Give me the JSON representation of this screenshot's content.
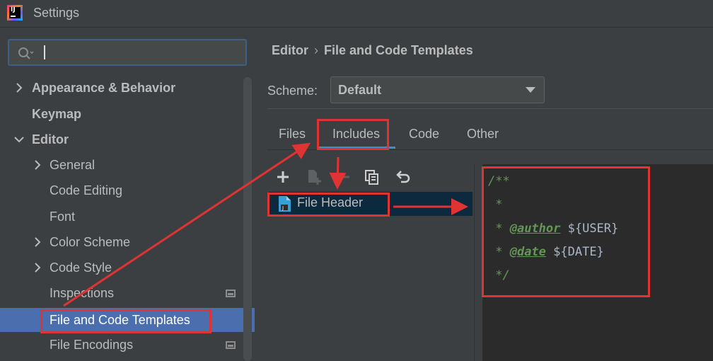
{
  "window": {
    "title": "Settings",
    "app_icon": "intellij-idea-icon",
    "app_icon_text": "IJ"
  },
  "search": {
    "value": "",
    "placeholder": ""
  },
  "sidebar": {
    "items": [
      {
        "label": "Appearance & Behavior",
        "expanded": false,
        "bold": true
      },
      {
        "label": "Keymap",
        "bold": true
      },
      {
        "label": "Editor",
        "expanded": true,
        "bold": true
      },
      {
        "label": "General",
        "expanded": false
      },
      {
        "label": "Code Editing"
      },
      {
        "label": "Font"
      },
      {
        "label": "Color Scheme",
        "expanded": false
      },
      {
        "label": "Code Style",
        "expanded": false
      },
      {
        "label": "Inspections",
        "has_project_icon": true
      },
      {
        "label": "File and Code Templates",
        "selected": true
      },
      {
        "label": "File Encodings",
        "has_project_icon": true
      }
    ]
  },
  "breadcrumb": {
    "parent": "Editor",
    "separator": "›",
    "current": "File and Code Templates"
  },
  "scheme": {
    "label": "Scheme:",
    "value": "Default"
  },
  "tabs": [
    {
      "label": "Files"
    },
    {
      "label": "Includes",
      "active": true
    },
    {
      "label": "Code"
    },
    {
      "label": "Other"
    }
  ],
  "toolbar": {
    "icons": [
      "plus-icon",
      "copy-template-icon",
      "minus-icon",
      "duplicate-icon",
      "undo-icon"
    ]
  },
  "template_list": {
    "items": [
      {
        "label": "File Header",
        "selected": true
      }
    ]
  },
  "editor": {
    "lines": [
      {
        "comment": "/**"
      },
      {
        "comment": " *"
      },
      {
        "comment": " * ",
        "tag": "@author",
        "var": " ${USER}"
      },
      {
        "comment": " * ",
        "tag": "@date",
        "var": " ${DATE}"
      },
      {
        "comment": " */"
      }
    ]
  },
  "colors": {
    "background": "#3c3f41",
    "selection": "#4b6eaf",
    "list_selection": "#0d293e",
    "editor_bg": "#2b2b2b",
    "comment": "#629755",
    "annotation": "#e03333",
    "tab_underline": "#4a88c7"
  }
}
